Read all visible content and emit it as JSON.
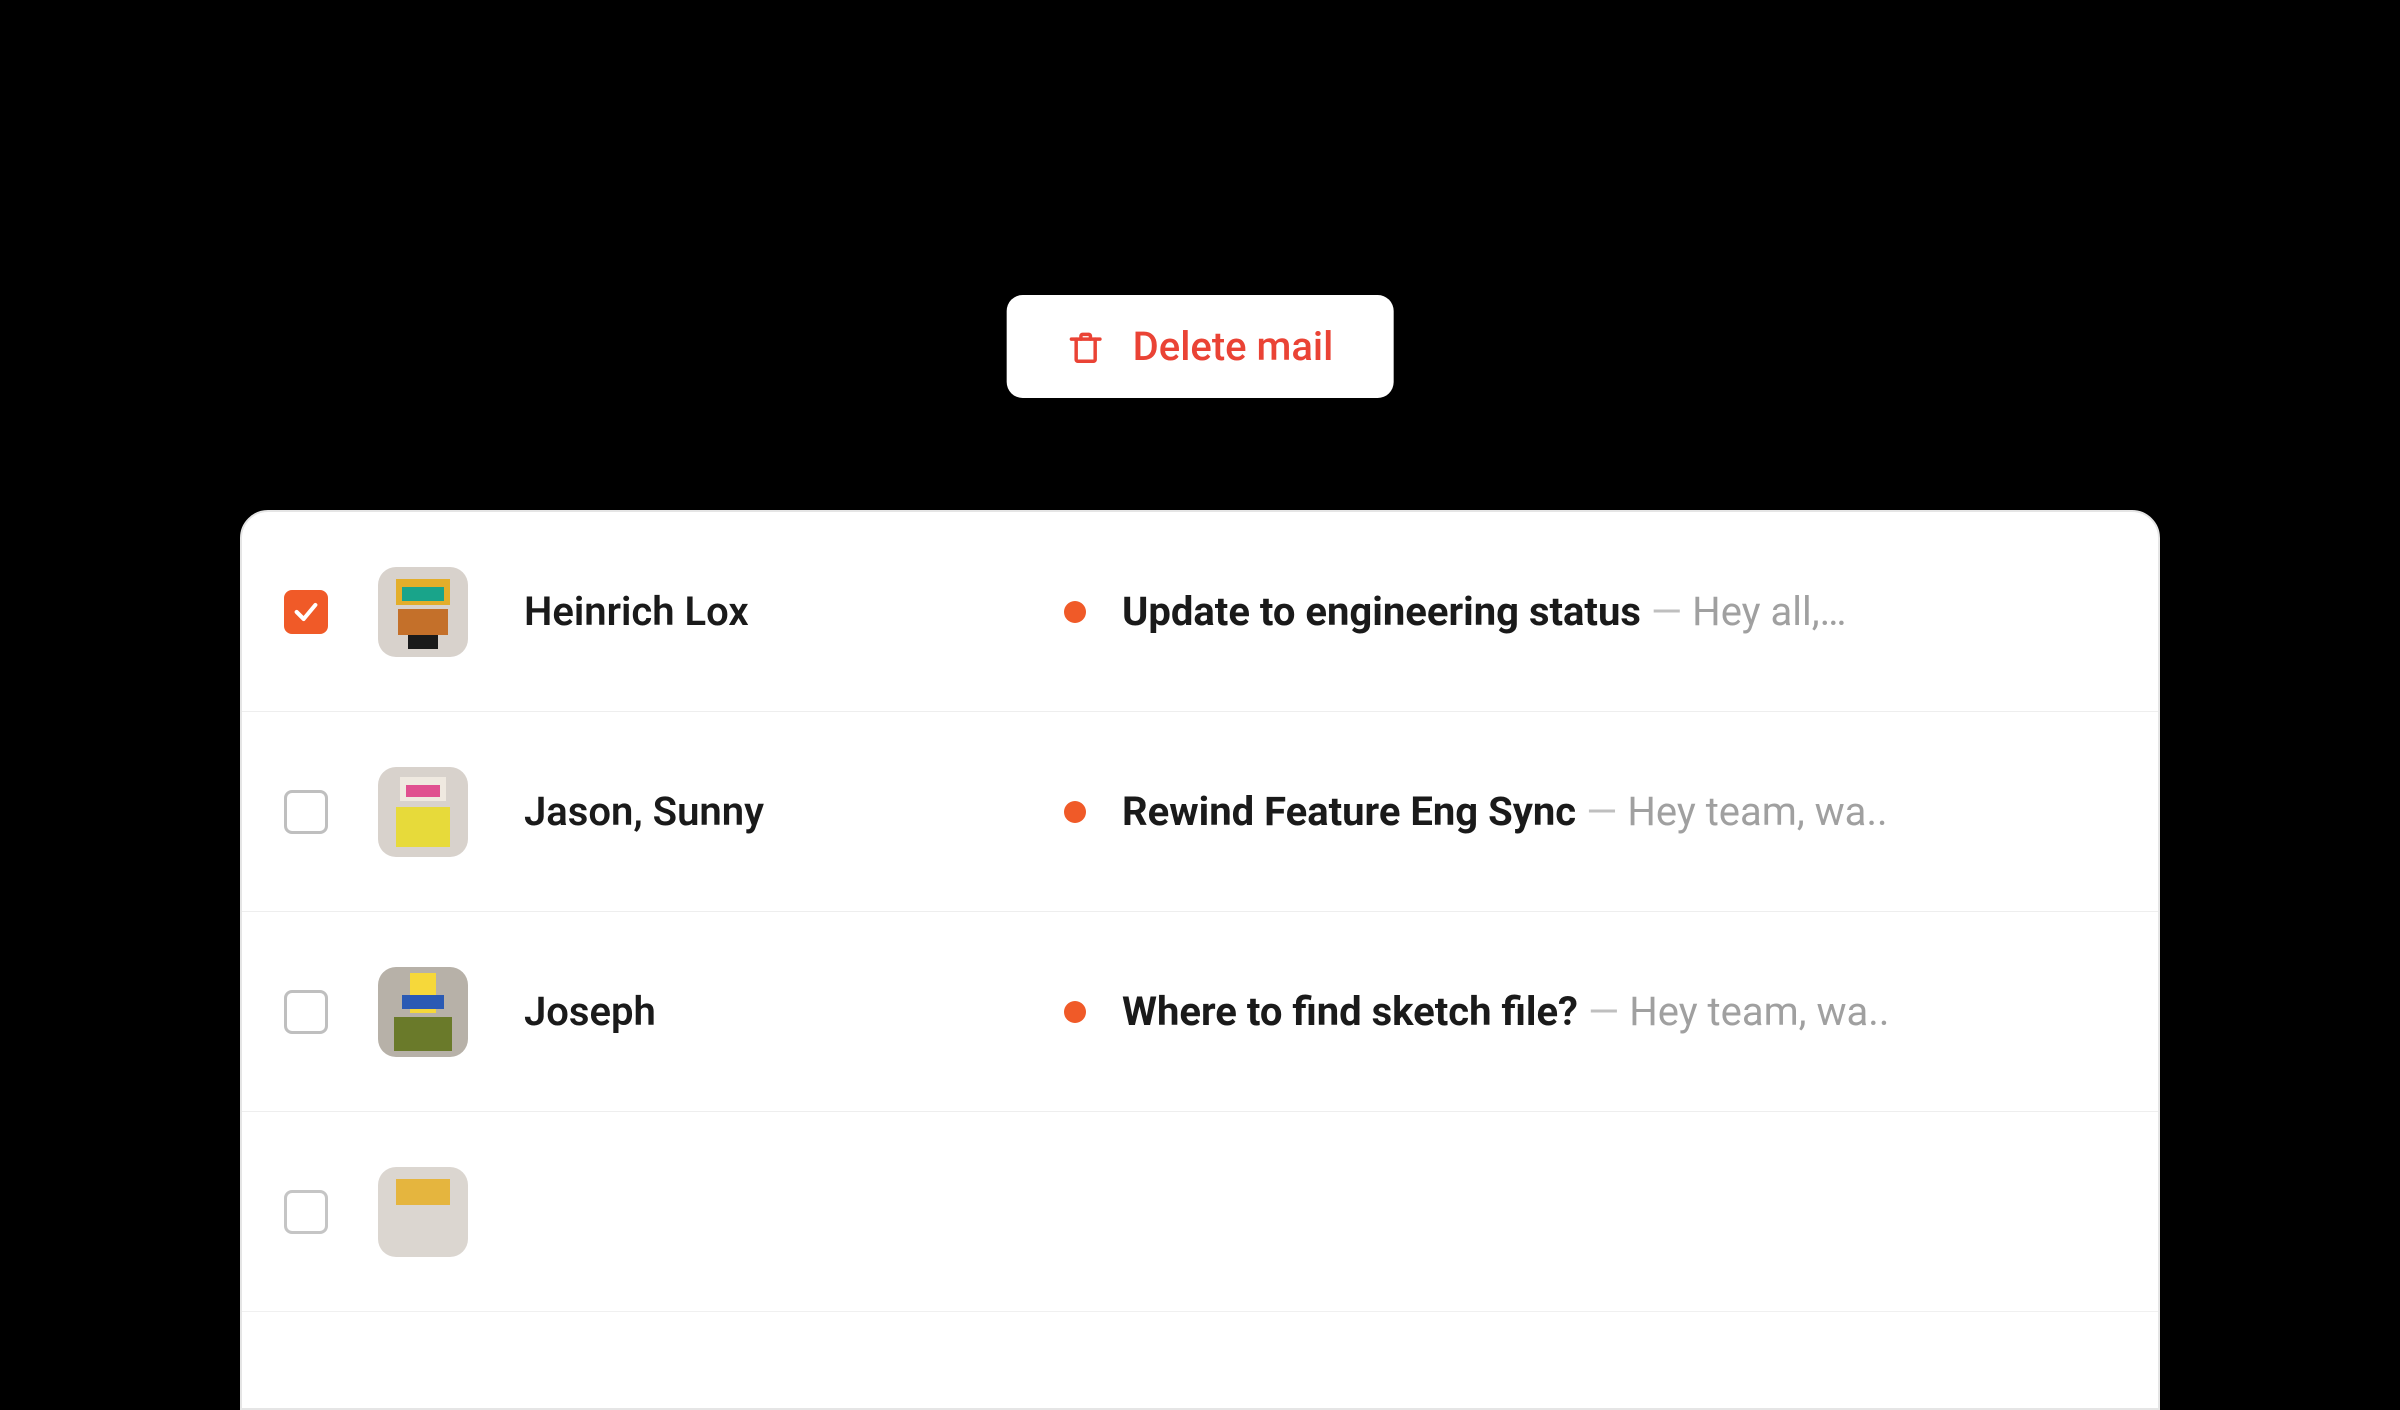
{
  "action_button": {
    "label": "Delete mail"
  },
  "colors": {
    "accent": "#f05a28",
    "danger": "#ea4335"
  },
  "mail": {
    "rows": [
      {
        "checked": true,
        "sender": "Heinrich Lox",
        "unread": true,
        "subject": "Update to engineering status",
        "preview": "Hey all,…"
      },
      {
        "checked": false,
        "sender": "Jason, Sunny",
        "unread": true,
        "subject": "Rewind Feature Eng Sync",
        "preview": "Hey team, wa.."
      },
      {
        "checked": false,
        "sender": "Joseph",
        "unread": true,
        "subject": "Where to find sketch file?",
        "preview": "Hey team, wa.."
      }
    ]
  }
}
